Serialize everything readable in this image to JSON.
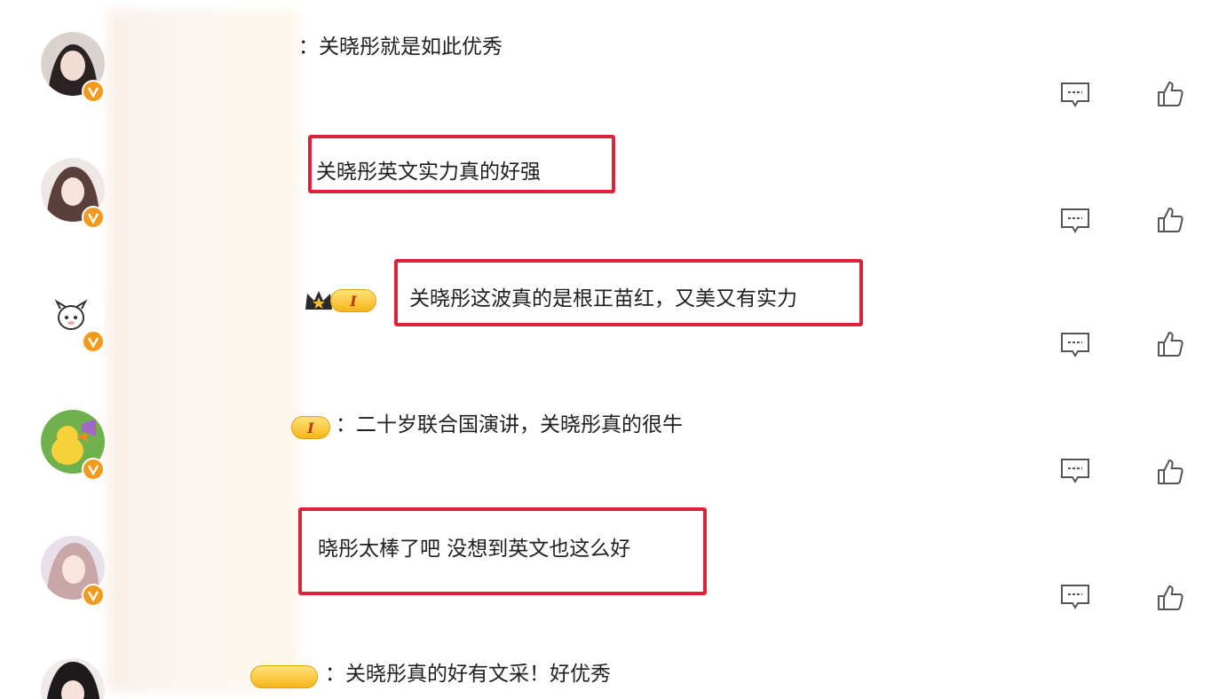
{
  "comments": [
    {
      "text": "：关晓彤就是如此优秀",
      "highlighted": false,
      "level_badge": ""
    },
    {
      "text": "关晓彤英文实力真的好强",
      "highlighted": true,
      "level_badge": ""
    },
    {
      "text": "关晓彤这波真的是根正苗红，又美又有实力",
      "highlighted": true,
      "level_badge": "I"
    },
    {
      "text": "：二十岁联合国演讲，关晓彤真的很牛",
      "highlighted": false,
      "level_badge": "I"
    },
    {
      "text": "晓彤太棒了吧 没想到英文也这么好",
      "highlighted": true,
      "level_badge": ""
    },
    {
      "text": "：关晓彤真的好有文采！好优秀",
      "highlighted": false,
      "level_badge": ""
    }
  ],
  "colors": {
    "highlight_border": "#d9243a",
    "vip_badge": "#f29a1d",
    "level_badge": "#f6b619"
  },
  "icons": {
    "reply": "comment-reply-icon",
    "like": "thumbs-up-icon",
    "verified": "vip-v-icon",
    "crown": "crown-icon"
  }
}
